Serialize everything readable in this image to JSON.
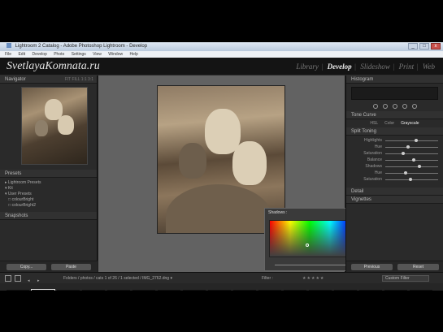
{
  "window": {
    "title": "Lightroom 2 Catalog - Adobe Photoshop Lightroom - Develop",
    "buttons": [
      "_",
      "□",
      "x"
    ]
  },
  "menu": [
    "File",
    "Edit",
    "Develop",
    "Photo",
    "Settings",
    "View",
    "Window",
    "Help"
  ],
  "identity": {
    "logo": "SvetlayaKomnata.ru",
    "modules": [
      "Library",
      "Develop",
      "Slideshow",
      "Print",
      "Web"
    ],
    "active_module": "Develop"
  },
  "left_panel": {
    "navigator": {
      "title": "Navigator",
      "zoom": "FIT  FILL  1:1  3:1"
    },
    "presets": {
      "title": "Presets",
      "items": [
        "Lightroom Presets",
        "Kit",
        "User Presets",
        "colourBright",
        "colourBright2"
      ]
    },
    "snapshots": {
      "title": "Snapshots"
    },
    "copy_label": "Copy...",
    "paste_label": "Paste"
  },
  "popup": {
    "title": "Shadows :",
    "swatch_colors": [
      "#7a7fa0",
      "#c9a050",
      "#6a8c5a",
      "#a86060",
      "#8c8c8c"
    ],
    "slider_value": 0.68
  },
  "right_panel": {
    "histogram": "Histogram",
    "tone_curve": "Tone Curve",
    "hsl_tabs": [
      "HSL",
      "Color",
      "Grayscale"
    ],
    "split_toning": "Split Toning",
    "split_rows": [
      {
        "label": "Highlights",
        "value": 0.55
      },
      {
        "label": "Hue",
        "value": 0.4
      },
      {
        "label": "Saturation",
        "value": 0.3
      },
      {
        "label": "Balance",
        "value": 0.5
      },
      {
        "label": "Shadows",
        "value": 0.62
      },
      {
        "label": "Hue",
        "value": 0.35
      },
      {
        "label": "Saturation",
        "value": 0.45
      }
    ],
    "detail": "Detail",
    "vignettes": "Vignettes",
    "previous_label": "Previous",
    "reset_label": "Reset"
  },
  "toolbar": {
    "breadcrumb": "Folders / photos / cats   1 of 26 / 1 selected / IMG_2762.dng ▾",
    "filter_label": "Filter :",
    "stars": "★★★★★",
    "filter_box": "Custom Filter"
  },
  "filmstrip": {
    "thumb_colors": [
      "#6a6a5a",
      "#c7b08a",
      "#8e8e8e",
      "#9a8c70",
      "#aab49c",
      "#6f7a6a",
      "#cfcfc8",
      "#7d8a78",
      "#b09474",
      "#7a8c6c",
      "#9aa890",
      "#8a9c84",
      "#a8b8a0",
      "#8a8a8a",
      "#707a6a",
      "#c8c8c8",
      "#5a5a5a"
    ],
    "selected_index": 1
  }
}
